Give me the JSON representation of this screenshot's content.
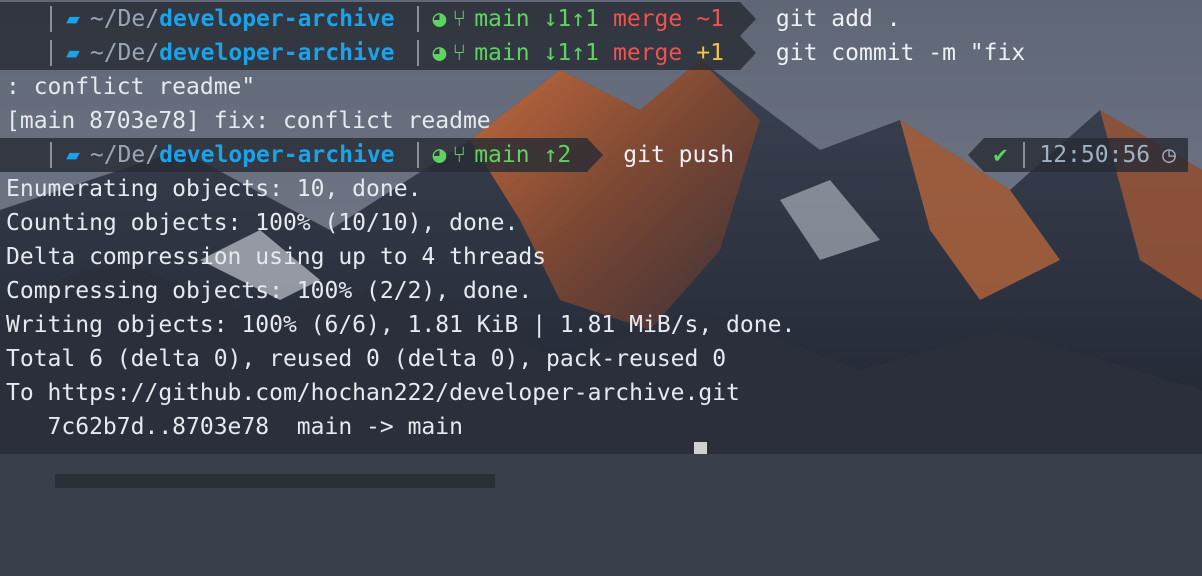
{
  "colors": {
    "dir": "#1aa3e8",
    "git_green": "#5fd35f",
    "git_red": "#f0534f",
    "git_yellow": "#f5c542",
    "segment_bg": "#282c34"
  },
  "prompts": [
    {
      "apple": "",
      "dir_prefix": "~/De/",
      "dir_name": "developer-archive",
      "branch": "main",
      "ahead_behind": "↓1↑1",
      "state": "merge",
      "change": "~1",
      "command": "git add ."
    },
    {
      "apple": "",
      "dir_prefix": "~/De/",
      "dir_name": "developer-archive",
      "branch": "main",
      "ahead_behind": "↓1↑1",
      "state": "merge",
      "change": "+1",
      "command": "git commit -m \"fix"
    },
    {
      "apple": "",
      "dir_prefix": "~/De/",
      "dir_name": "developer-archive",
      "branch": "main",
      "ahead_behind": "↑2",
      "command": "git push",
      "status_mark": "✔",
      "time": "12:50:56"
    }
  ],
  "outputs": {
    "commit_cont": ": conflict readme\"",
    "commit_result": "[main 8703e78] fix: conflict readme",
    "push_lines": [
      "Enumerating objects: 10, done.",
      "Counting objects: 100% (10/10), done.",
      "Delta compression using up to 4 threads",
      "Compressing objects: 100% (2/2), done.",
      "Writing objects: 100% (6/6), 1.81 KiB | 1.81 MiB/s, done.",
      "Total 6 (delta 0), reused 0 (delta 0), pack-reused 0",
      "To https://github.com/hochan222/developer-archive.git",
      "   7c62b7d..8703e78  main -> main"
    ]
  },
  "icons": {
    "folder": "folder-icon",
    "github": "github-icon",
    "branch": "git-branch-icon",
    "clock": "clock-icon"
  }
}
